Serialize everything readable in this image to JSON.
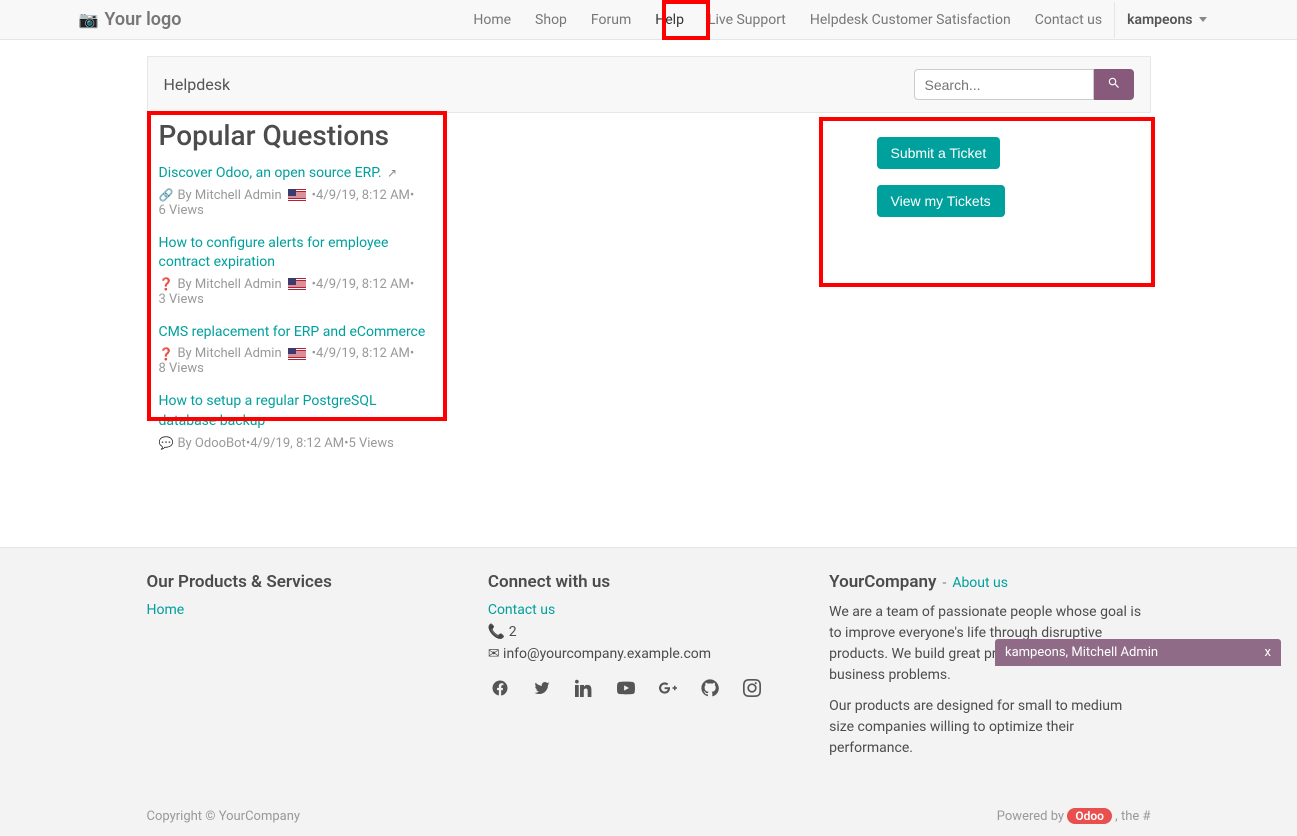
{
  "nav": {
    "logo_label": "Your logo",
    "items": [
      {
        "label": "Home"
      },
      {
        "label": "Shop"
      },
      {
        "label": "Forum"
      },
      {
        "label": "Help"
      },
      {
        "label": "Live Support"
      },
      {
        "label": "Helpdesk Customer Satisfaction"
      },
      {
        "label": "Contact us"
      }
    ],
    "user": "kampeons"
  },
  "subbar": {
    "title": "Helpdesk",
    "search_placeholder": "Search..."
  },
  "popular": {
    "title": "Popular Questions",
    "items": [
      {
        "title": "Discover Odoo, an open source ERP.",
        "author": "By Mitchell Admin",
        "date": "4/9/19, 8:12 AM",
        "views": "6 Views",
        "external": true,
        "icon": "link"
      },
      {
        "title": "How to configure alerts for employee contract expiration",
        "author": "By Mitchell Admin",
        "date": "4/9/19, 8:12 AM",
        "views": "3 Views",
        "icon": "question"
      },
      {
        "title": "CMS replacement for ERP and eCommerce",
        "author": "By Mitchell Admin",
        "date": "4/9/19, 8:12 AM",
        "views": "8 Views",
        "icon": "question"
      },
      {
        "title": "How to setup a regular PostgreSQL database backup",
        "author": "By OdooBot",
        "date": "4/9/19, 8:12 AM",
        "views": "5 Views",
        "icon": "comment",
        "no_flag": true
      }
    ]
  },
  "actions": {
    "submit": "Submit a Ticket",
    "view": "View my Tickets"
  },
  "footer": {
    "products_title": "Our Products & Services",
    "products_link": "Home",
    "connect_title": "Connect with us",
    "contact_us": "Contact us",
    "phone": "2",
    "email": "info@yourcompany.example.com",
    "company_title": "YourCompany",
    "about_sep": "-",
    "about_label": "About us",
    "company_desc1": "We are a team of passionate people whose goal is to improve everyone's life through disruptive products. We build great products to solve your business problems.",
    "company_desc2": "Our products are designed for small to medium size companies willing to optimize their performance.",
    "copyright": "Copyright © YourCompany",
    "powered_pre": "Powered by ",
    "odoo": "Odoo",
    "powered_post": ", the #"
  },
  "chat": {
    "title": "kampeons, Mitchell Admin",
    "close": "x"
  }
}
